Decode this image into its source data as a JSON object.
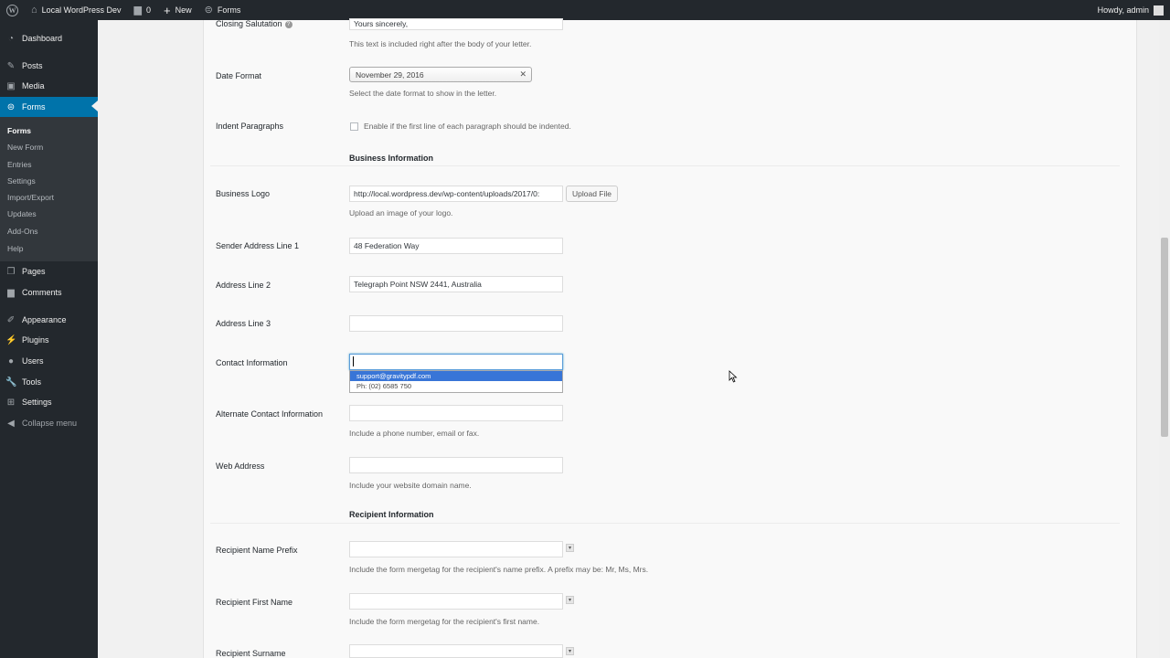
{
  "adminbar": {
    "site_name": "Local WordPress Dev",
    "comments_count": "0",
    "new_label": "New",
    "forms_label": "Forms",
    "howdy": "Howdy, admin"
  },
  "sidebar": {
    "dashboard": "Dashboard",
    "posts": "Posts",
    "media": "Media",
    "forms": "Forms",
    "submenu": [
      "Forms",
      "New Form",
      "Entries",
      "Settings",
      "Import/Export",
      "Updates",
      "Add-Ons",
      "Help"
    ],
    "pages": "Pages",
    "comments": "Comments",
    "appearance": "Appearance",
    "plugins": "Plugins",
    "users": "Users",
    "tools": "Tools",
    "settings": "Settings",
    "collapse": "Collapse menu"
  },
  "form": {
    "closing_salutation": {
      "label": "Closing Salutation",
      "value": "Yours sincerely,",
      "desc": "This text is included right after the body of your letter."
    },
    "date_format": {
      "label": "Date Format",
      "value": "November 29, 2016",
      "desc": "Select the date format to show in the letter."
    },
    "indent_paragraphs": {
      "label": "Indent Paragraphs",
      "checkbox_label": "Enable if the first line of each paragraph should be indented."
    },
    "business_section": "Business Information",
    "business_logo": {
      "label": "Business Logo",
      "value": "http://local.wordpress.dev/wp-content/uploads/2017/0:",
      "button": "Upload File",
      "desc": "Upload an image of your logo."
    },
    "sender_address_1": {
      "label": "Sender Address Line 1",
      "value": "48 Federation Way"
    },
    "address_2": {
      "label": "Address Line 2",
      "value": "Telegraph Point NSW 2441, Australia"
    },
    "address_3": {
      "label": "Address Line 3",
      "value": ""
    },
    "contact_info": {
      "label": "Contact Information",
      "value": "",
      "suggestions": [
        "support@gravitypdf.com",
        "Ph: (02) 6585 750"
      ]
    },
    "alt_contact": {
      "label": "Alternate Contact Information",
      "value": "",
      "desc": "Include a phone number, email or fax."
    },
    "web_address": {
      "label": "Web Address",
      "value": "",
      "desc": "Include your website domain name."
    },
    "recipient_section": "Recipient Information",
    "recipient_prefix": {
      "label": "Recipient Name Prefix",
      "value": "",
      "desc": "Include the form mergetag for the recipient's name prefix. A prefix may be: Mr, Ms, Mrs."
    },
    "recipient_first": {
      "label": "Recipient First Name",
      "value": "",
      "desc": "Include the form mergetag for the recipient's first name."
    },
    "recipient_surname": {
      "label": "Recipient Surname",
      "value": ""
    }
  },
  "colors": {
    "adminbar": "#23282d",
    "accent": "#0073aa",
    "highlight": "#3875d7"
  }
}
